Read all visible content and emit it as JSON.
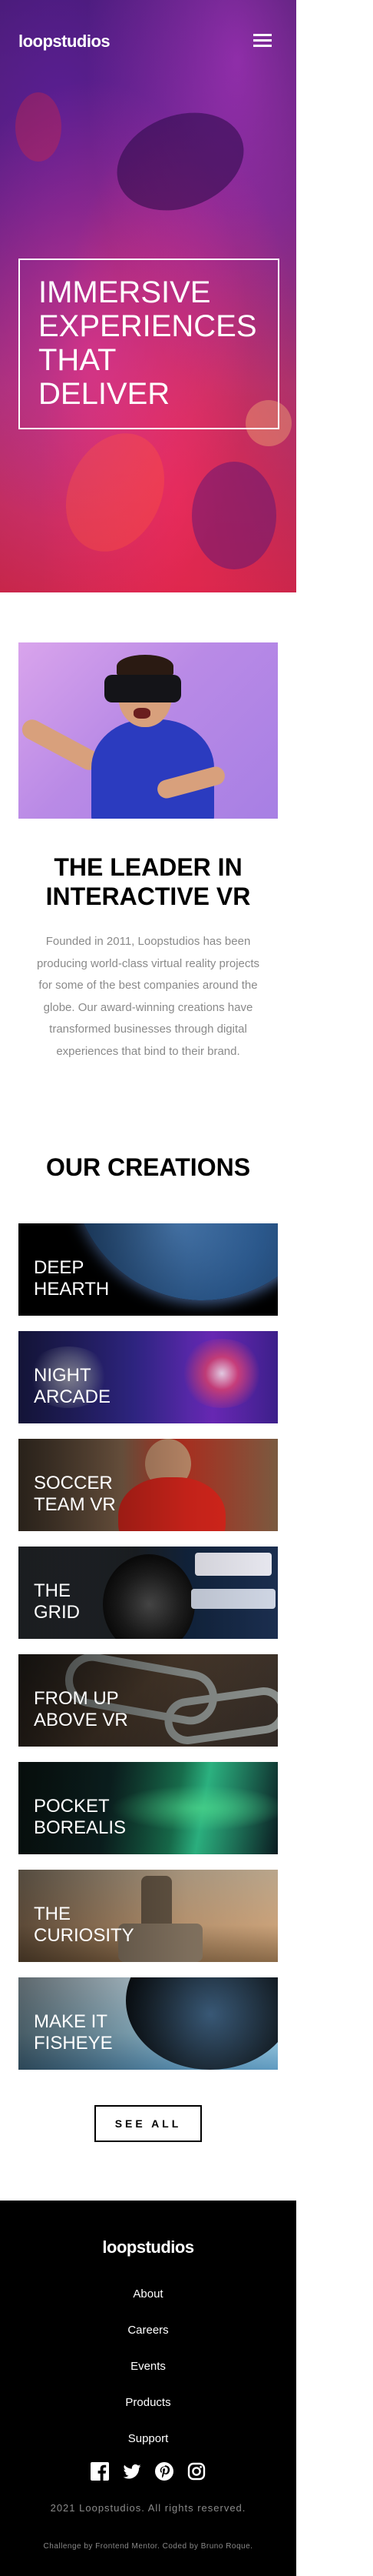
{
  "header": {
    "logo": "loopstudios",
    "menu_icon": "hamburger-menu-icon"
  },
  "hero": {
    "title": "IMMERSIVE\nEXPERIENCES\nTHAT\nDELIVER"
  },
  "intro": {
    "image_alt": "man wearing VR headset",
    "title": "THE LEADER IN\nINTERACTIVE VR",
    "text": "Founded in 2011, Loopstudios has been producing world-class virtual reality projects for some of the best companies around the globe. Our award-winning creations have transformed businesses through digital experiences that bind to their brand."
  },
  "creations": {
    "title": "OUR CREATIONS",
    "items": [
      {
        "label": "DEEP\nHEARTH"
      },
      {
        "label": "NIGHT\nARCADE"
      },
      {
        "label": "SOCCER\nTEAM VR"
      },
      {
        "label": "THE\nGRID"
      },
      {
        "label": "FROM UP\nABOVE VR"
      },
      {
        "label": "POCKET\nBOREALIS"
      },
      {
        "label": "THE\nCURIOSITY"
      },
      {
        "label": "MAKE IT\nFISHEYE"
      }
    ],
    "see_all_label": "SEE ALL"
  },
  "footer": {
    "logo": "loopstudios",
    "nav": [
      "About",
      "Careers",
      "Events",
      "Products",
      "Support"
    ],
    "socials": [
      "facebook-icon",
      "twitter-icon",
      "pinterest-icon",
      "instagram-icon"
    ],
    "copyright": "2021 Loopstudios. All rights reserved.",
    "attribution_prefix": "Challenge by ",
    "attribution_link1": "Frontend Mentor",
    "attribution_mid": ". Coded by ",
    "attribution_link2": "Bruno Roque",
    "attribution_suffix": "."
  }
}
